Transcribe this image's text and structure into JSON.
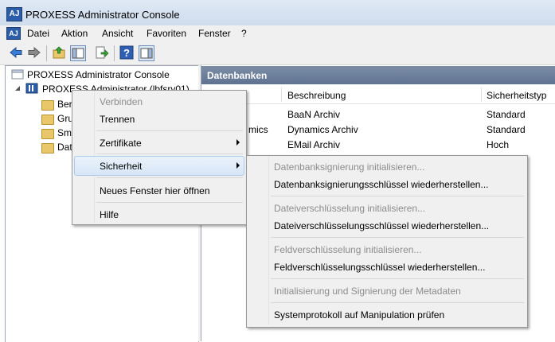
{
  "window": {
    "title": "PROXESS Administrator Console",
    "icon_text": "AJ"
  },
  "menubar": {
    "items": [
      {
        "label": "Datei"
      },
      {
        "label": "Aktion"
      },
      {
        "label": "Ansicht"
      },
      {
        "label": "Favoriten"
      },
      {
        "label": "Fenster"
      },
      {
        "label": "?"
      }
    ]
  },
  "toolbar": {
    "icons": [
      "back-arrow-icon",
      "forward-arrow-icon",
      "up-folder-icon",
      "show-hide-tree-icon",
      "export-list-icon",
      "help-icon",
      "show-hide-action-pane-icon"
    ]
  },
  "tree": {
    "root": "PROXESS Administrator Console",
    "server": "PROXESS Administrator (lbfsrv01)",
    "children": [
      "Ber",
      "Gru",
      "Sma",
      "Dat"
    ]
  },
  "right_pane": {
    "header": "Datenbanken",
    "columns": [
      "Beschreibung",
      "Sicherheitstyp"
    ],
    "partial_name": "mics",
    "rows": [
      {
        "description": "BaaN Archiv",
        "security": "Standard"
      },
      {
        "description": "Dynamics Archiv",
        "security": "Standard"
      },
      {
        "description": "EMail Archiv",
        "security": "Hoch"
      }
    ]
  },
  "context_menu": {
    "items": [
      {
        "label": "Verbinden",
        "enabled": false
      },
      {
        "label": "Trennen",
        "enabled": true
      },
      {
        "label": "Zertifikate",
        "enabled": true,
        "submenu": true
      },
      {
        "label": "Sicherheit",
        "enabled": true,
        "submenu": true,
        "highlighted": true
      },
      {
        "label": "Neues Fenster hier öffnen",
        "enabled": true
      },
      {
        "label": "Hilfe",
        "enabled": true
      }
    ]
  },
  "security_submenu": {
    "items": [
      {
        "label": "Datenbanksignierung initialisieren...",
        "enabled": false
      },
      {
        "label": "Datenbanksignierungsschlüssel wiederherstellen...",
        "enabled": true
      },
      {
        "label": "Dateiverschlüsselung initialisieren...",
        "enabled": false
      },
      {
        "label": "Dateiverschlüsselungsschlüssel wiederherstellen...",
        "enabled": true
      },
      {
        "label": "Feldverschlüsselung initialisieren...",
        "enabled": false
      },
      {
        "label": "Feldverschlüsselungsschlüssel wiederherstellen...",
        "enabled": true
      },
      {
        "label": "Initialisierung und Signierung der Metadaten",
        "enabled": false
      },
      {
        "label": "Systemprotokoll auf Manipulation prüfen",
        "enabled": true
      }
    ]
  },
  "colors": {
    "header_bg": "#6b7e9b",
    "menu_highlight": "#d6e6f7",
    "disabled_text": "#8d8d8d"
  }
}
